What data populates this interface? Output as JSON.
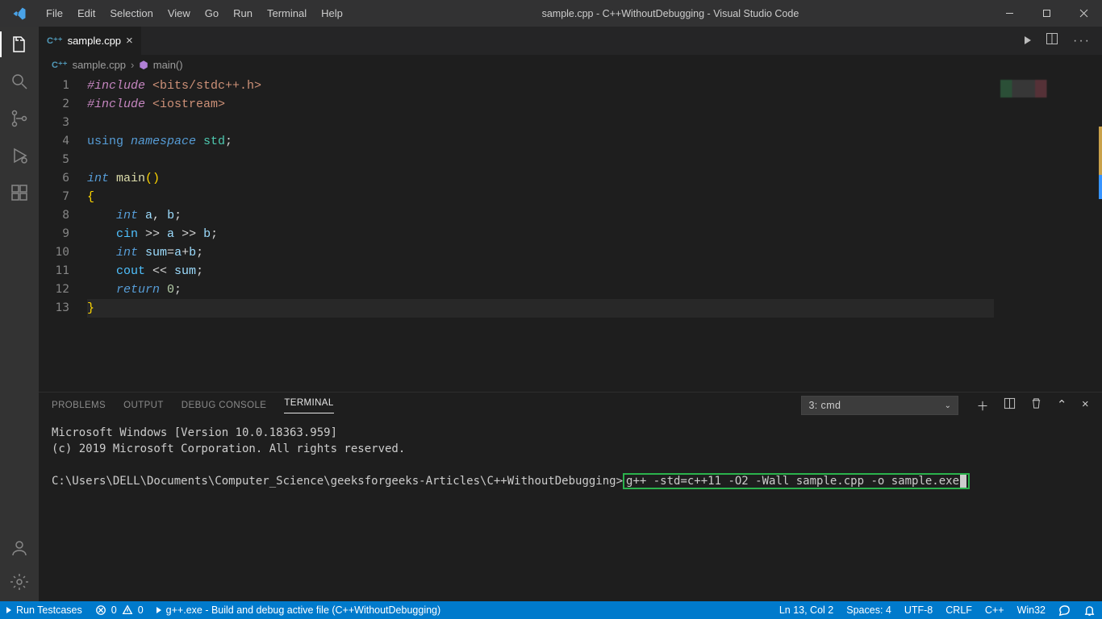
{
  "titlebar": {
    "menus": [
      "File",
      "Edit",
      "Selection",
      "View",
      "Go",
      "Run",
      "Terminal",
      "Help"
    ],
    "title": "sample.cpp - C++WithoutDebugging - Visual Studio Code"
  },
  "tab": {
    "label": "sample.cpp"
  },
  "breadcrumb": {
    "file": "sample.cpp",
    "symbol": "main()"
  },
  "code": {
    "lines": [
      [
        [
          "pp",
          "#include "
        ],
        [
          "inc",
          "<bits/stdc++.h>"
        ]
      ],
      [
        [
          "pp",
          "#include "
        ],
        [
          "inc",
          "<iostream>"
        ]
      ],
      [],
      [
        [
          "kw",
          "using "
        ],
        [
          "kwit",
          "namespace "
        ],
        [
          "type",
          "std"
        ],
        [
          "pun",
          ";"
        ]
      ],
      [],
      [
        [
          "kwit",
          "int "
        ],
        [
          "fn",
          "main"
        ],
        [
          "brc",
          "()"
        ]
      ],
      [
        [
          "brc",
          "{"
        ]
      ],
      [
        [
          "pun",
          "    "
        ],
        [
          "kwit",
          "int "
        ],
        [
          "ident",
          "a"
        ],
        [
          "pun",
          ", "
        ],
        [
          "ident",
          "b"
        ],
        [
          "pun",
          ";"
        ]
      ],
      [
        [
          "pun",
          "    "
        ],
        [
          "strm",
          "cin"
        ],
        [
          "op",
          " >> "
        ],
        [
          "ident",
          "a"
        ],
        [
          "op",
          " >> "
        ],
        [
          "ident",
          "b"
        ],
        [
          "pun",
          ";"
        ]
      ],
      [
        [
          "pun",
          "    "
        ],
        [
          "kwit",
          "int "
        ],
        [
          "ident",
          "sum"
        ],
        [
          "op",
          "="
        ],
        [
          "ident",
          "a"
        ],
        [
          "op",
          "+"
        ],
        [
          "ident",
          "b"
        ],
        [
          "pun",
          ";"
        ]
      ],
      [
        [
          "pun",
          "    "
        ],
        [
          "strm",
          "cout"
        ],
        [
          "op",
          " << "
        ],
        [
          "ident",
          "sum"
        ],
        [
          "pun",
          ";"
        ]
      ],
      [
        [
          "pun",
          "    "
        ],
        [
          "kwit",
          "return "
        ],
        [
          "num",
          "0"
        ],
        [
          "pun",
          ";"
        ]
      ],
      [
        [
          "brc",
          "}"
        ]
      ]
    ],
    "current_line_index": 12
  },
  "panel": {
    "tabs": [
      "PROBLEMS",
      "OUTPUT",
      "DEBUG CONSOLE",
      "TERMINAL"
    ],
    "active_tab": 3,
    "term_select": "3: cmd",
    "terminal": {
      "header1": "Microsoft Windows [Version 10.0.18363.959]",
      "header2": "(c) 2019 Microsoft Corporation. All rights reserved.",
      "cwd": "C:\\Users\\DELL\\Documents\\Computer_Science\\geeksforgeeks-Articles\\C++WithoutDebugging>",
      "command": "g++ -std=c++11 -O2 -Wall sample.cpp -o sample.exe"
    }
  },
  "status": {
    "run_testcases": "Run Testcases",
    "errors": "0",
    "warnings": "0",
    "build_task": "g++.exe - Build and debug active file (C++WithoutDebugging)",
    "cursor": "Ln 13, Col 2",
    "spaces": "Spaces: 4",
    "encoding": "UTF-8",
    "eol": "CRLF",
    "lang": "C++",
    "platform": "Win32"
  }
}
